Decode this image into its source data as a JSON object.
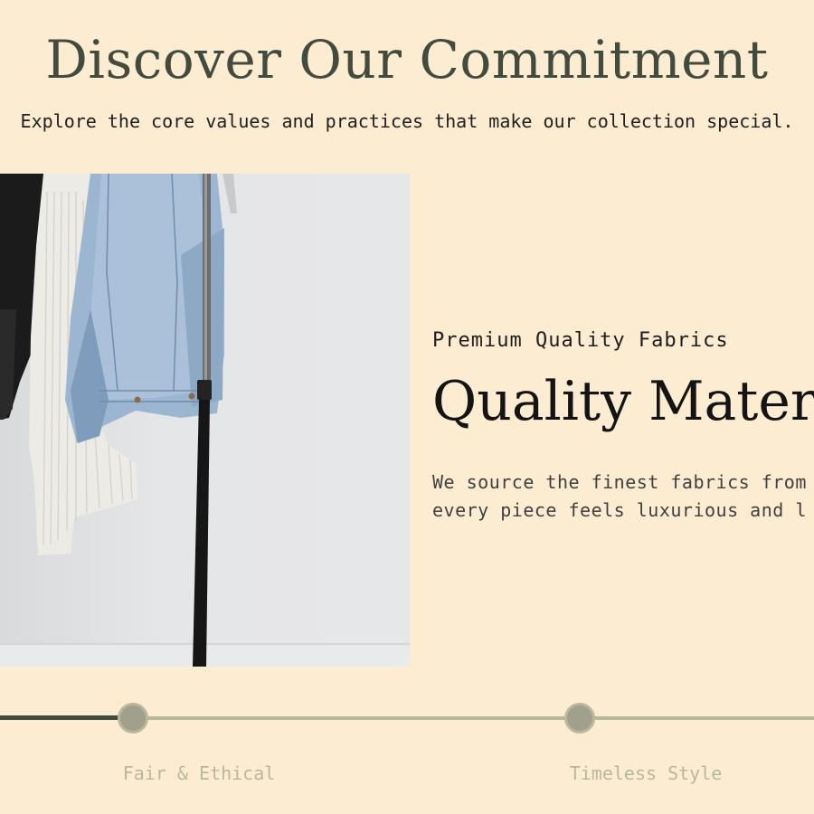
{
  "header": {
    "title": "Discover Our Commitment",
    "subtitle": "Explore the core values and practices that make our collection special."
  },
  "feature": {
    "image_alt": "Clothing rack with black, white knit and denim jackets",
    "kicker": "Premium Quality Fabrics",
    "heading": "Quality Materials",
    "body_lines": [
      "We source the finest fabrics from",
      "every piece feels luxurious and l"
    ]
  },
  "timeline": {
    "active_index": 0,
    "progress_fraction": 0.165,
    "steps": [
      {
        "label": "Fair & Ethical"
      },
      {
        "label": "Timeless Style"
      }
    ]
  },
  "colors": {
    "background": "#fcecd2",
    "title": "#434b3f",
    "track": "#b6b79c",
    "progress": "#434b3f",
    "dot": "#a1a08c",
    "inactive_label": "#b8b8a0"
  }
}
